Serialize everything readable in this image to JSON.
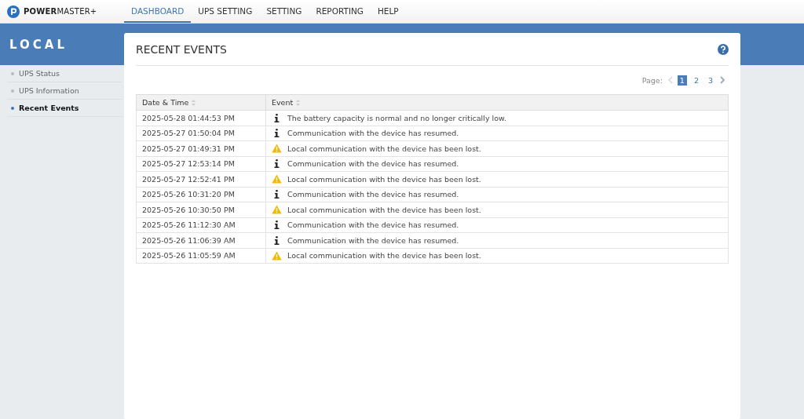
{
  "brand": "**POWER**MASTER+",
  "nav": [
    {
      "label": "DASHBOARD",
      "selected": true
    },
    {
      "label": "UPS SETTING",
      "selected": false
    },
    {
      "label": "SETTING",
      "selected": false
    },
    {
      "label": "REPORTING",
      "selected": false
    },
    {
      "label": "HELP",
      "selected": false
    }
  ],
  "sidebar": {
    "title": "LOCAL",
    "items": [
      {
        "label": "UPS Status",
        "selected": false
      },
      {
        "label": "UPS Information",
        "selected": false
      },
      {
        "label": "Recent Events",
        "selected": true
      }
    ]
  },
  "panel": {
    "title": "RECENT EVENTS",
    "pagination": {
      "label": "Page:",
      "prev_disabled": true,
      "pages": [
        {
          "label": "1",
          "selected": true
        },
        {
          "label": "2",
          "selected": false
        },
        {
          "label": "3",
          "selected": false
        }
      ]
    },
    "table": {
      "columns": [
        "Date & Time",
        "Event"
      ],
      "rows": [
        {
          "time": "2025-05-28 01:44:53 PM",
          "kind": "info",
          "event": "The battery capacity is normal and no longer critically low."
        },
        {
          "time": "2025-05-27 01:50:04 PM",
          "kind": "info",
          "event": "Communication with the device has resumed."
        },
        {
          "time": "2025-05-27 01:49:31 PM",
          "kind": "warning",
          "event": "Local communication with the device has been lost."
        },
        {
          "time": "2025-05-27 12:53:14 PM",
          "kind": "info",
          "event": "Communication with the device has resumed."
        },
        {
          "time": "2025-05-27 12:52:41 PM",
          "kind": "warning",
          "event": "Local communication with the device has been lost."
        },
        {
          "time": "2025-05-26 10:31:20 PM",
          "kind": "info",
          "event": "Communication with the device has resumed."
        },
        {
          "time": "2025-05-26 10:30:50 PM",
          "kind": "warning",
          "event": "Local communication with the device has been lost."
        },
        {
          "time": "2025-05-26 11:12:30 AM",
          "kind": "info",
          "event": "Communication with the device has resumed."
        },
        {
          "time": "2025-05-26 11:06:39 AM",
          "kind": "info",
          "event": "Communication with the device has resumed."
        },
        {
          "time": "2025-05-26 11:05:59 AM",
          "kind": "warning",
          "event": "Local communication with the device has been lost."
        }
      ]
    }
  }
}
